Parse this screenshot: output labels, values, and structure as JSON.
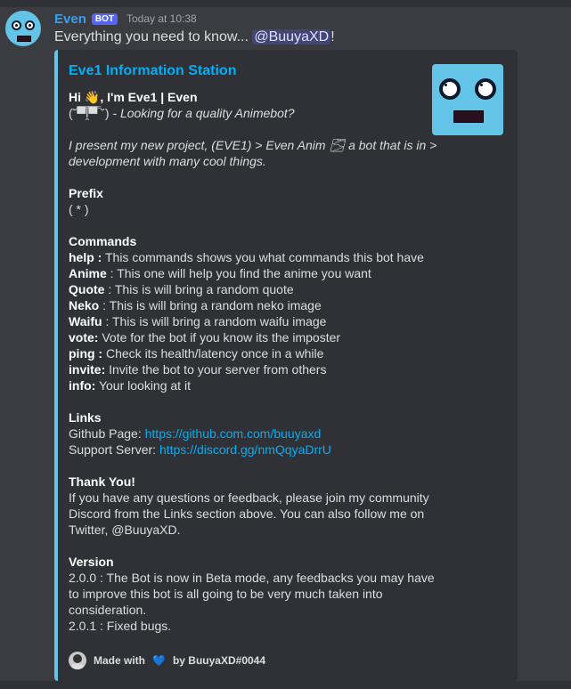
{
  "message": {
    "author": "Even",
    "badge": "BOT",
    "timestamp": "Today at 10:38",
    "text_before": "Everything you need to know... ",
    "mention": "@BuuyaXD",
    "text_after": "!"
  },
  "embed": {
    "accent_color": "#64c3e8",
    "title": "Eve1 Information Station",
    "greeting": "Hi 👋, I'm Eve1 | Even",
    "kaomoji": "(˘▀̿ĺ̯▀̿ ˘)",
    "tagline": " - Looking for a quality Animebot?",
    "intro_line1": "I present my new project, (EVE1) > Even Anim 🌫 a bot that is in >",
    "intro_line2": "development with many cool things.",
    "prefix": {
      "heading": "Prefix",
      "value": "( * )"
    },
    "commands": {
      "heading": "Commands",
      "items": [
        {
          "name": "help :",
          "desc": " This commands shows you what commands this bot have"
        },
        {
          "name": "Anime",
          "desc": " : This one will help you find the anime you want"
        },
        {
          "name": "Quote",
          "desc": " : This is will bring a random quote"
        },
        {
          "name": "Neko",
          "desc": " : This is will bring a random neko image"
        },
        {
          "name": "Waifu",
          "desc": " : This is will bring a random waifu image"
        },
        {
          "name": "vote:",
          "desc": " Vote for the bot if you know its the imposter"
        },
        {
          "name": "ping :",
          "desc": " Check its health/latency once in a while"
        },
        {
          "name": "invite:",
          "desc": " Invite the bot to your server from others"
        },
        {
          "name": "info:",
          "desc": " Your looking at it"
        }
      ]
    },
    "links": {
      "heading": "Links",
      "github_label": "Github Page: ",
      "github_url": "https://github.com.com/buuyaxd",
      "support_label": "Support Server: ",
      "support_url": "https://discord.gg/nmQqyaDrrU"
    },
    "thanks": {
      "heading": "Thank You!",
      "line1": "If you have any questions or feedback, please join my community",
      "line2": "Discord from the Links section above. You can also follow me on",
      "line3": "Twitter, @BuuyaXD."
    },
    "version": {
      "heading": "Version",
      "line1": "2.0.0 : The Bot is now in Beta mode, any feedbacks you may have",
      "line2": "to improve this bot is all going to be very much taken into",
      "line3": "consideration.",
      "line4": "2.0.1 : Fixed bugs."
    },
    "footer": {
      "made_with": "Made with",
      "heart": "💙",
      "by": "by BuuyaXD#0044"
    }
  }
}
